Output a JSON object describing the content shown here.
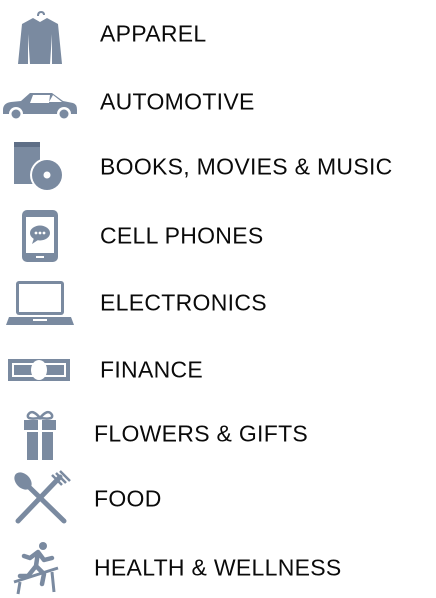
{
  "categories": [
    {
      "label": "APPAREL",
      "icon": "shirt-icon"
    },
    {
      "label": "AUTOMOTIVE",
      "icon": "car-icon"
    },
    {
      "label": "BOOKS, MOVIES & MUSIC",
      "icon": "book-disc-icon"
    },
    {
      "label": "CELL PHONES",
      "icon": "cell-phone-icon"
    },
    {
      "label": "ELECTRONICS",
      "icon": "laptop-icon"
    },
    {
      "label": "FINANCE",
      "icon": "banknote-icon"
    },
    {
      "label": "FLOWERS & GIFTS",
      "icon": "gift-icon"
    },
    {
      "label": "FOOD",
      "icon": "fork-spoon-icon"
    },
    {
      "label": "HEALTH & WELLNESS",
      "icon": "runner-icon"
    }
  ],
  "colors": {
    "icon": "#7a8aa0",
    "text": "#0a0a0a",
    "background": "#ffffff"
  }
}
